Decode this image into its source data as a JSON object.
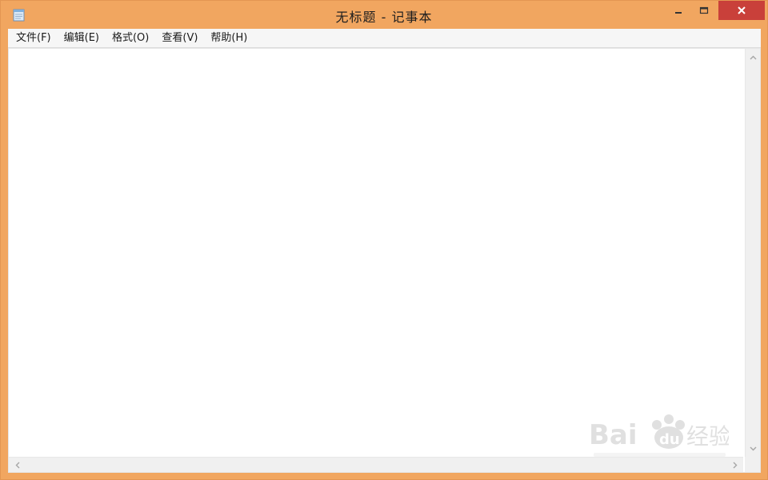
{
  "window": {
    "title": "无标题 - 记事本",
    "accent_color": "#f1a660",
    "close_color": "#c9403a"
  },
  "icons": {
    "app": "notepad-icon",
    "minimize": "minimize-icon",
    "maximize": "maximize-icon",
    "close": "close-icon",
    "scroll_up": "chevron-up-icon",
    "scroll_down": "chevron-down-icon",
    "scroll_left": "chevron-left-icon",
    "scroll_right": "chevron-right-icon"
  },
  "menu": {
    "items": [
      {
        "label": "文件(F)"
      },
      {
        "label": "编辑(E)"
      },
      {
        "label": "格式(O)"
      },
      {
        "label": "查看(V)"
      },
      {
        "label": "帮助(H)"
      }
    ]
  },
  "editor": {
    "content": ""
  },
  "watermark": {
    "text": "Bai du 经验"
  }
}
